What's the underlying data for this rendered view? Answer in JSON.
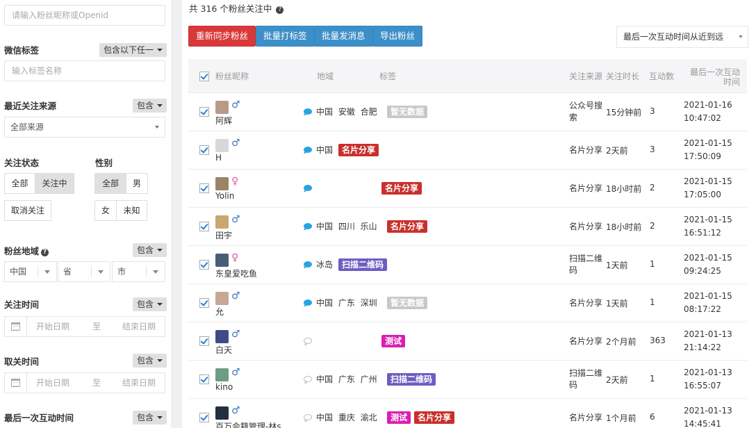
{
  "filters": {
    "search_placeholder": "请输入粉丝昵称或Openid",
    "wechat_tag": {
      "label": "微信标签",
      "mode": "包含以下任一",
      "placeholder": "输入标签名称"
    },
    "recent_source": {
      "label": "最近关注来源",
      "mode": "包含",
      "value": "全部来源"
    },
    "follow_status": {
      "label": "关注状态",
      "options": [
        "全部",
        "关注中",
        "取消关注"
      ],
      "selected": "关注中"
    },
    "gender": {
      "label": "性别",
      "options": [
        "全部",
        "男",
        "女",
        "未知"
      ],
      "selected": "全部"
    },
    "region": {
      "label": "粉丝地域",
      "mode": "包含",
      "country": "中国",
      "province": "省",
      "city": "市"
    },
    "follow_time": {
      "label": "关注时间",
      "mode": "包含",
      "start": "开始日期",
      "to": "至",
      "end": "结束日期"
    },
    "unfollow_time": {
      "label": "取关时间",
      "mode": "包含",
      "start": "开始日期",
      "to": "至",
      "end": "结束日期"
    },
    "last_interact": {
      "label": "最后一次互动时间",
      "mode": "包含"
    }
  },
  "summary": {
    "prefix": "共",
    "count": "316",
    "suffix": "个粉丝关注中"
  },
  "toolbar": {
    "resync": "重新同步粉丝",
    "batch_tag": "批量打标签",
    "batch_msg": "批量发消息",
    "export": "导出粉丝",
    "sort": "最后一次互动时间从近到远"
  },
  "colors": {
    "resync": "#d9383a",
    "blue_btn": "#3d8fc9",
    "tag_gray": "#c8c8c8",
    "tag_red": "#c9302c",
    "tag_purple": "#6c5ec2",
    "tag_magenta": "#d91fb2"
  },
  "table": {
    "headers": {
      "nickname": "粉丝昵称",
      "region": "地域",
      "tags": "标签",
      "source": "关注来源",
      "duration": "关注时长",
      "interactions": "互动数",
      "last_time": "最后一次互动时间"
    },
    "rows": [
      {
        "nick": "阿辉",
        "gender": "♂",
        "g": "m",
        "chat": true,
        "region": "中国 安徽 合肥",
        "tags": [
          {
            "t": "暂无数据",
            "c": "gray"
          }
        ],
        "source": "公众号搜索",
        "duration": "15分钟前",
        "count": "3",
        "time": "2021-01-16 10:47:02"
      },
      {
        "nick": "H",
        "gender": "♂",
        "g": "m",
        "chat": true,
        "region": "中国",
        "tags": [
          {
            "t": "名片分享",
            "c": "red"
          }
        ],
        "source": "名片分享",
        "duration": "2天前",
        "count": "3",
        "time": "2021-01-15 17:50:09"
      },
      {
        "nick": "Yolin",
        "gender": "♀",
        "g": "f",
        "chat": true,
        "region": "",
        "tags": [
          {
            "t": "名片分享",
            "c": "red"
          }
        ],
        "source": "名片分享",
        "duration": "18小时前",
        "count": "2",
        "time": "2021-01-15 17:05:00"
      },
      {
        "nick": "田宇",
        "gender": "♂",
        "g": "m",
        "chat": true,
        "region": "中国 四川 乐山",
        "tags": [
          {
            "t": "名片分享",
            "c": "red"
          }
        ],
        "source": "名片分享",
        "duration": "18小时前",
        "count": "2",
        "time": "2021-01-15 16:51:12"
      },
      {
        "nick": "东皇爱吃鱼",
        "gender": "♀",
        "g": "f",
        "chat": true,
        "region": "冰岛",
        "tags": [
          {
            "t": "扫描二维码",
            "c": "purple"
          }
        ],
        "source": "扫描二维码",
        "duration": "1天前",
        "count": "1",
        "time": "2021-01-15 09:24:25"
      },
      {
        "nick": "允",
        "gender": "♂",
        "g": "m",
        "chat": true,
        "region": "中国 广东 深圳",
        "tags": [
          {
            "t": "暂无数据",
            "c": "gray"
          }
        ],
        "source": "名片分享",
        "duration": "1天前",
        "count": "1",
        "time": "2021-01-15 08:17:22"
      },
      {
        "nick": "白天",
        "gender": "♂",
        "g": "m",
        "chat": false,
        "region": "",
        "tags": [
          {
            "t": "测试",
            "c": "magenta"
          }
        ],
        "source": "名片分享",
        "duration": "2个月前",
        "count": "363",
        "time": "2021-01-13 21:14:22"
      },
      {
        "nick": "kino",
        "gender": "♂",
        "g": "m",
        "chat": false,
        "region": "中国 广东 广州",
        "tags": [
          {
            "t": "扫描二维码",
            "c": "purple"
          }
        ],
        "source": "扫描二维码",
        "duration": "2天前",
        "count": "1",
        "time": "2021-01-13 16:55:07"
      },
      {
        "nick": "百万会籍管理-林s",
        "gender": "♂",
        "g": "m",
        "chat": false,
        "region": "中国 重庆 渝北",
        "tags": [
          {
            "t": "测试",
            "c": "magenta"
          },
          {
            "t": "名片分享",
            "c": "red"
          }
        ],
        "source": "名片分享",
        "duration": "1个月前",
        "count": "6",
        "time": "2021-01-13 14:45:41"
      }
    ]
  }
}
